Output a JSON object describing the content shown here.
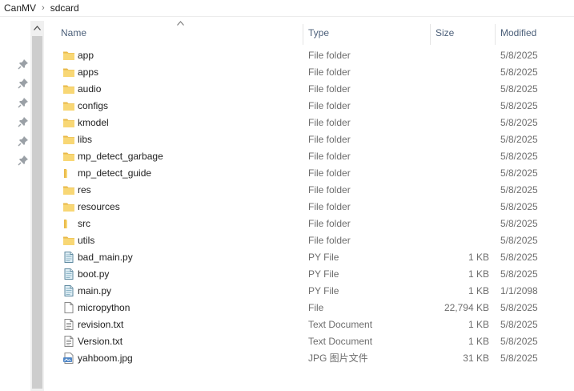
{
  "breadcrumb": {
    "items": [
      "CanMV",
      "sdcard"
    ],
    "separator": "›"
  },
  "columns": {
    "name": "Name",
    "type": "Type",
    "size": "Size",
    "modified": "Modified"
  },
  "colors": {
    "folder": "#F8D775",
    "folder_dark": "#E9B949",
    "header_text": "#4C607A",
    "secondary_text": "#6D6D6D"
  },
  "icons": {
    "folder": "folder-icon",
    "python": "python-file-icon",
    "file": "generic-file-icon",
    "text": "text-file-icon",
    "image": "image-file-icon",
    "pin": "pin-icon",
    "scroll": "scroll-up-arrow-icon"
  },
  "files": [
    {
      "name": "app",
      "type": "File folder",
      "size": "",
      "modified": "5/8/2025",
      "kind": "folder"
    },
    {
      "name": "apps",
      "type": "File folder",
      "size": "",
      "modified": "5/8/2025",
      "kind": "folder"
    },
    {
      "name": "audio",
      "type": "File folder",
      "size": "",
      "modified": "5/8/2025",
      "kind": "folder"
    },
    {
      "name": "configs",
      "type": "File folder",
      "size": "",
      "modified": "5/8/2025",
      "kind": "folder"
    },
    {
      "name": "kmodel",
      "type": "File folder",
      "size": "",
      "modified": "5/8/2025",
      "kind": "folder"
    },
    {
      "name": "libs",
      "type": "File folder",
      "size": "",
      "modified": "5/8/2025",
      "kind": "folder"
    },
    {
      "name": "mp_detect_garbage",
      "type": "File folder",
      "size": "",
      "modified": "5/8/2025",
      "kind": "folder"
    },
    {
      "name": "mp_detect_guide",
      "type": "File folder",
      "size": "",
      "modified": "5/8/2025",
      "kind": "folder-thin"
    },
    {
      "name": "res",
      "type": "File folder",
      "size": "",
      "modified": "5/8/2025",
      "kind": "folder"
    },
    {
      "name": "resources",
      "type": "File folder",
      "size": "",
      "modified": "5/8/2025",
      "kind": "folder"
    },
    {
      "name": "src",
      "type": "File folder",
      "size": "",
      "modified": "5/8/2025",
      "kind": "folder-thin"
    },
    {
      "name": "utils",
      "type": "File folder",
      "size": "",
      "modified": "5/8/2025",
      "kind": "folder"
    },
    {
      "name": "bad_main.py",
      "type": "PY File",
      "size": "1 KB",
      "modified": "5/8/2025",
      "kind": "python"
    },
    {
      "name": "boot.py",
      "type": "PY File",
      "size": "1 KB",
      "modified": "5/8/2025",
      "kind": "python"
    },
    {
      "name": "main.py",
      "type": "PY File",
      "size": "1 KB",
      "modified": "1/1/2098",
      "kind": "python"
    },
    {
      "name": "micropython",
      "type": "File",
      "size": "22,794 KB",
      "modified": "5/8/2025",
      "kind": "file"
    },
    {
      "name": "revision.txt",
      "type": "Text Document",
      "size": "1 KB",
      "modified": "5/8/2025",
      "kind": "text"
    },
    {
      "name": "Version.txt",
      "type": "Text Document",
      "size": "1 KB",
      "modified": "5/8/2025",
      "kind": "text"
    },
    {
      "name": "yahboom.jpg",
      "type": "JPG 图片文件",
      "size": "31 KB",
      "modified": "5/8/2025",
      "kind": "image"
    }
  ]
}
